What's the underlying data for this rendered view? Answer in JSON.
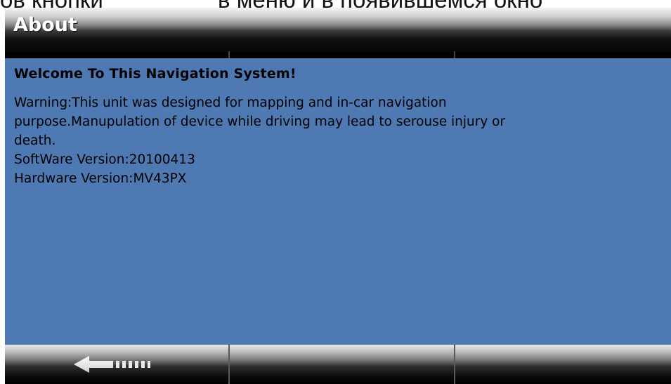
{
  "top_caption": {
    "left_text": "ов кнопки",
    "right_text": "в меню и в появившемся окно"
  },
  "title_bar": {
    "title": "About"
  },
  "content": {
    "heading": "Welcome To This Navigation System!",
    "warning_line1": "Warning:This unit was designed for mapping and in-car navigation",
    "warning_line2": "purpose.Manupulation of device while driving may lead to serouse injury or",
    "warning_line3": "death.",
    "software_version": "SoftWare Version:20100413",
    "hardware_version": "Hardware Version:MV43PX"
  },
  "bottom_bar": {
    "back_icon": "back-arrow-icon"
  },
  "colors": {
    "content_bg": "#4f79b2",
    "title_text": "#ffffff",
    "body_text": "#000000"
  }
}
